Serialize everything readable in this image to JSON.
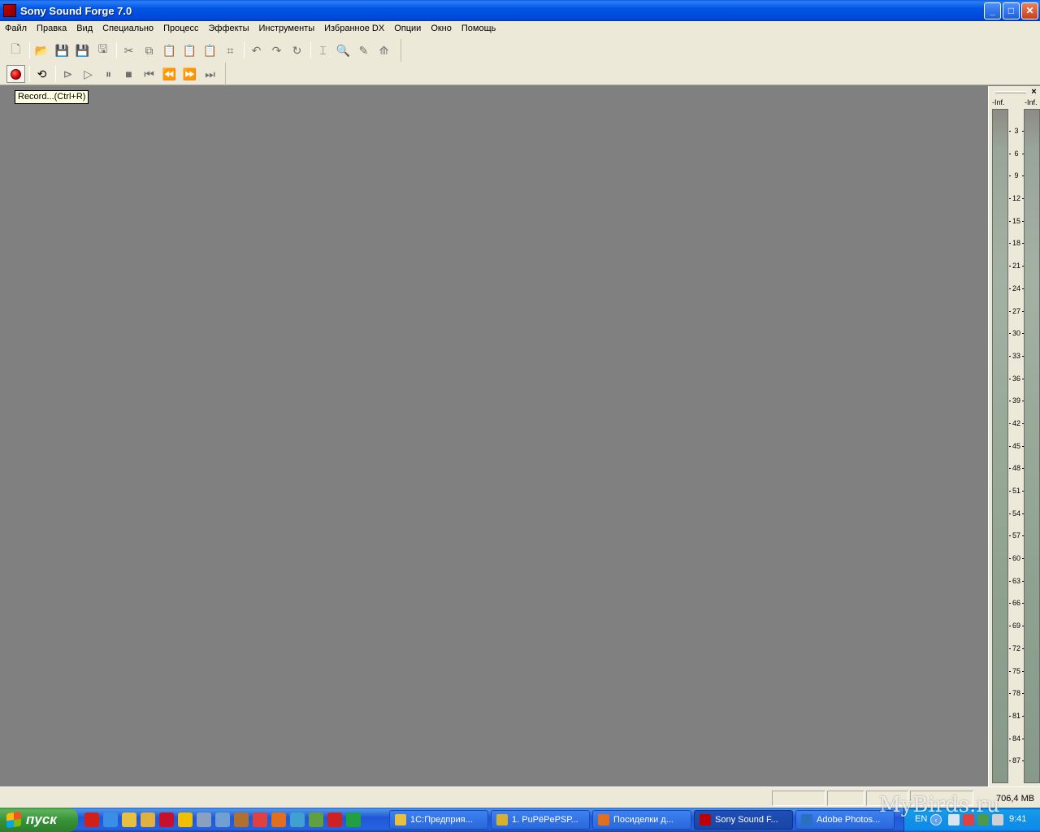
{
  "window": {
    "title": "Sony Sound Forge 7.0",
    "controls": {
      "minimize": "_",
      "maximize": "□",
      "close": "✕"
    }
  },
  "menu": [
    "Файл",
    "Правка",
    "Вид",
    "Специально",
    "Процесс",
    "Эффекты",
    "Инструменты",
    "Избранное DX",
    "Опции",
    "Окно",
    "Помощь"
  ],
  "toolbar_main": [
    {
      "name": "new-file-icon",
      "glyph": "🗋"
    },
    {
      "sep": true
    },
    {
      "name": "open-icon",
      "glyph": "📂"
    },
    {
      "name": "save-icon",
      "glyph": "💾"
    },
    {
      "name": "save-as-icon",
      "glyph": "💾"
    },
    {
      "name": "save-all-icon",
      "glyph": "🖫"
    },
    {
      "sep": true
    },
    {
      "name": "cut-icon",
      "glyph": "✂"
    },
    {
      "name": "copy-icon",
      "glyph": "⧉"
    },
    {
      "name": "paste-icon",
      "glyph": "📋"
    },
    {
      "name": "paste-special-icon",
      "glyph": "📋"
    },
    {
      "name": "mix-icon",
      "glyph": "📋"
    },
    {
      "name": "crop-icon",
      "glyph": "⌗"
    },
    {
      "sep": true
    },
    {
      "name": "undo-icon",
      "glyph": "↶"
    },
    {
      "name": "redo-icon",
      "glyph": "↷"
    },
    {
      "name": "repeat-icon",
      "glyph": "↻"
    },
    {
      "sep": true
    },
    {
      "name": "edit-tool-icon",
      "glyph": "⌶"
    },
    {
      "name": "magnify-tool-icon",
      "glyph": "🔍"
    },
    {
      "name": "pencil-tool-icon",
      "glyph": "✎"
    },
    {
      "name": "envelope-tool-icon",
      "glyph": "⟰"
    }
  ],
  "toolbar_transport": [
    {
      "name": "record-icon",
      "glyph": "",
      "active": true
    },
    {
      "sep": true
    },
    {
      "name": "loop-icon",
      "glyph": "⟲",
      "active": true
    },
    {
      "sep": true
    },
    {
      "name": "play-all-icon",
      "glyph": "⊳"
    },
    {
      "name": "play-icon",
      "glyph": "▷"
    },
    {
      "name": "pause-icon",
      "glyph": "⏸"
    },
    {
      "name": "stop-icon",
      "glyph": "■"
    },
    {
      "name": "go-to-start-icon",
      "glyph": "⏮"
    },
    {
      "name": "rewind-icon",
      "glyph": "⏪"
    },
    {
      "name": "forward-icon",
      "glyph": "⏩"
    },
    {
      "name": "go-to-end-icon",
      "glyph": "⏭"
    }
  ],
  "tooltip": "Record...(Ctrl+R)",
  "meters": {
    "peak_left": "-Inf.",
    "peak_right": "-Inf.",
    "close": "×",
    "scale": [
      "3",
      "6",
      "9",
      "12",
      "15",
      "18",
      "21",
      "24",
      "27",
      "30",
      "33",
      "36",
      "39",
      "42",
      "45",
      "48",
      "51",
      "54",
      "57",
      "60",
      "63",
      "66",
      "69",
      "72",
      "75",
      "78",
      "81",
      "84",
      "87"
    ]
  },
  "status": {
    "memory": "706,4 MB"
  },
  "taskbar": {
    "start": "пуск",
    "quicklaunch": [
      {
        "name": "opera-icon",
        "color": "#d0201a"
      },
      {
        "name": "ie-icon",
        "color": "#3a8ee6"
      },
      {
        "name": "tool-icon",
        "color": "#e8c040"
      },
      {
        "name": "folder-icon",
        "color": "#e0b040"
      },
      {
        "name": "acrobat-icon",
        "color": "#c8102e"
      },
      {
        "name": "clock-app-icon",
        "color": "#f0c000"
      },
      {
        "name": "app-icon-7",
        "color": "#8aa0c0"
      },
      {
        "name": "monitor-icon",
        "color": "#6fa0d0"
      },
      {
        "name": "app-icon-9",
        "color": "#b07030"
      },
      {
        "name": "target-icon",
        "color": "#e04040"
      },
      {
        "name": "firefox-icon",
        "color": "#e07020"
      },
      {
        "name": "app-icon-12",
        "color": "#40a0d0"
      },
      {
        "name": "network-icon",
        "color": "#60a040"
      },
      {
        "name": "pdf-icon",
        "color": "#d02020"
      },
      {
        "name": "app-icon-15",
        "color": "#20a040"
      }
    ],
    "tasks": [
      {
        "label": "1С:Предприя...",
        "icon_color": "#e8c040"
      },
      {
        "label": "1. PuРёРeРЅР...",
        "icon_color": "#d8b030"
      },
      {
        "label": "Посиделки д...",
        "icon_color": "#e07020"
      },
      {
        "label": "Sony Sound F...",
        "icon_color": "#c00000",
        "active": true
      },
      {
        "label": "Adobe Photos...",
        "icon_color": "#2a70c0"
      }
    ],
    "lang": "EN",
    "chevron": "‹",
    "clock": "9:41"
  },
  "watermark": "MyBirds.ru",
  "colors": {
    "xp_blue": "#0055e5",
    "workspace": "#808080",
    "face": "#ece9d8"
  }
}
